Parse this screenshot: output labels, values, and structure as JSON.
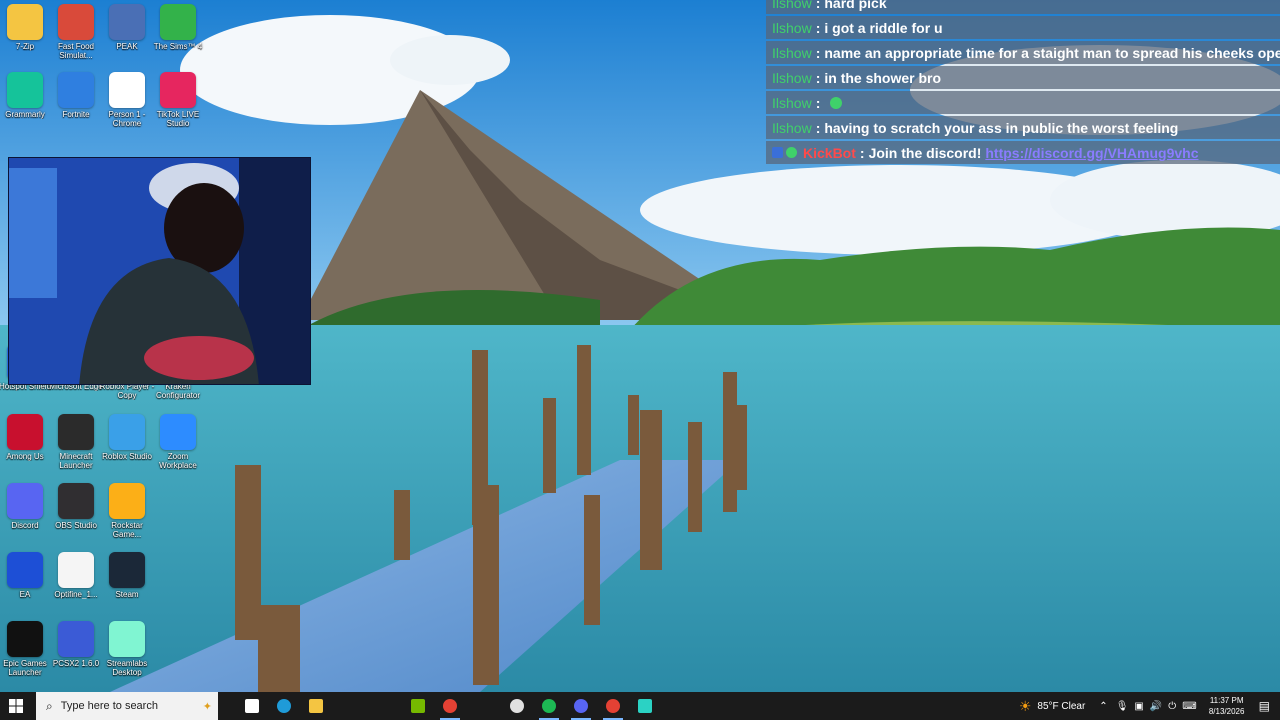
{
  "desktop_icons": [
    {
      "label": "7-Zip",
      "icon": "folder-icon",
      "color": "#f4c542"
    },
    {
      "label": "Fast Food Simulat...",
      "icon": "fastfood-icon",
      "color": "#d94a3a"
    },
    {
      "label": "PEAK",
      "icon": "peak-icon",
      "color": "#4a6fb5"
    },
    {
      "label": "The Sims™ 4",
      "icon": "sims-icon",
      "color": "#33b24a"
    },
    {
      "label": "Grammarly",
      "icon": "grammarly-icon",
      "color": "#15c39a"
    },
    {
      "label": "Fortnite",
      "icon": "fortnite-icon",
      "color": "#2f7fe0"
    },
    {
      "label": "Person 1 - Chrome",
      "icon": "chrome-icon",
      "color": "#ffffff"
    },
    {
      "label": "TikTok LIVE Studio",
      "icon": "tiktok-icon",
      "color": "#e6265f"
    },
    {
      "label": "Hotspot Shield",
      "icon": "hotspot-shield-icon",
      "color": "#2a6dd9"
    },
    {
      "label": "Microsoft Edge",
      "icon": "edge-icon",
      "color": "#1f9bd8"
    },
    {
      "label": "Roblox Player - Copy",
      "icon": "roblox-icon",
      "color": "#e8e8e8"
    },
    {
      "label": "Kraken Configurator",
      "icon": "kraken-icon",
      "color": "#7a3cff"
    },
    {
      "label": "Among Us",
      "icon": "among-us-icon",
      "color": "#c8102e"
    },
    {
      "label": "Minecraft Launcher",
      "icon": "minecraft-icon",
      "color": "#2b2b2b"
    },
    {
      "label": "Roblox Studio",
      "icon": "roblox-studio-icon",
      "color": "#3aa0e8"
    },
    {
      "label": "Zoom Workplace",
      "icon": "zoom-icon",
      "color": "#2d8cff"
    },
    {
      "label": "Discord",
      "icon": "discord-icon",
      "color": "#5865f2"
    },
    {
      "label": "OBS Studio",
      "icon": "obs-icon",
      "color": "#302e31"
    },
    {
      "label": "Rockstar Game...",
      "icon": "rockstar-icon",
      "color": "#fcaf17"
    },
    {
      "label": "EA",
      "icon": "ea-icon",
      "color": "#1d4fd6"
    },
    {
      "label": "Optifine_1...",
      "icon": "java-icon",
      "color": "#f5f5f5"
    },
    {
      "label": "Steam",
      "icon": "steam-icon",
      "color": "#1b2838"
    },
    {
      "label": "Epic Games Launcher",
      "icon": "epic-games-icon",
      "color": "#111111"
    },
    {
      "label": "PCSX2 1.6.0",
      "icon": "pcsx2-icon",
      "color": "#3b5bd6"
    },
    {
      "label": "Streamlabs Desktop",
      "icon": "streamlabs-icon",
      "color": "#80f5d2"
    }
  ],
  "chat": {
    "messages": [
      {
        "user": "Ilshow",
        "text": "hard pick"
      },
      {
        "user": "Ilshow",
        "text": "i got a riddle for u"
      },
      {
        "user": "Ilshow",
        "text": "name an appropriate time for a staight man to spread his cheeks open"
      },
      {
        "user": "Ilshow",
        "text": "in the shower bro"
      },
      {
        "user": "Ilshow",
        "text": "",
        "emote": "green-emote-icon"
      },
      {
        "user": "Ilshow",
        "text": "having to scratch your ass in public the worst feeling"
      }
    ],
    "bot": {
      "user": "KickBot",
      "text": "Join the discord!",
      "link": "https://discord.gg/VHAmug9vhc"
    }
  },
  "taskbar": {
    "search_placeholder": "Type here to search",
    "weather": "85°F  Clear",
    "time": "11:37 PM",
    "date": "8/13/2026",
    "apps": [
      "task-view-icon",
      "edge-icon",
      "file-explorer-icon",
      "nvidia-icon",
      "chrome-icon",
      "obs-icon",
      "spotify-icon",
      "discord-icon",
      "chrome-icon",
      "terminal-icon"
    ]
  },
  "colors": {
    "chat_user": "#3fd16a",
    "kickbot": "#ff4a4a",
    "link": "#8a7cff",
    "taskbar": "#1b1b1b"
  }
}
